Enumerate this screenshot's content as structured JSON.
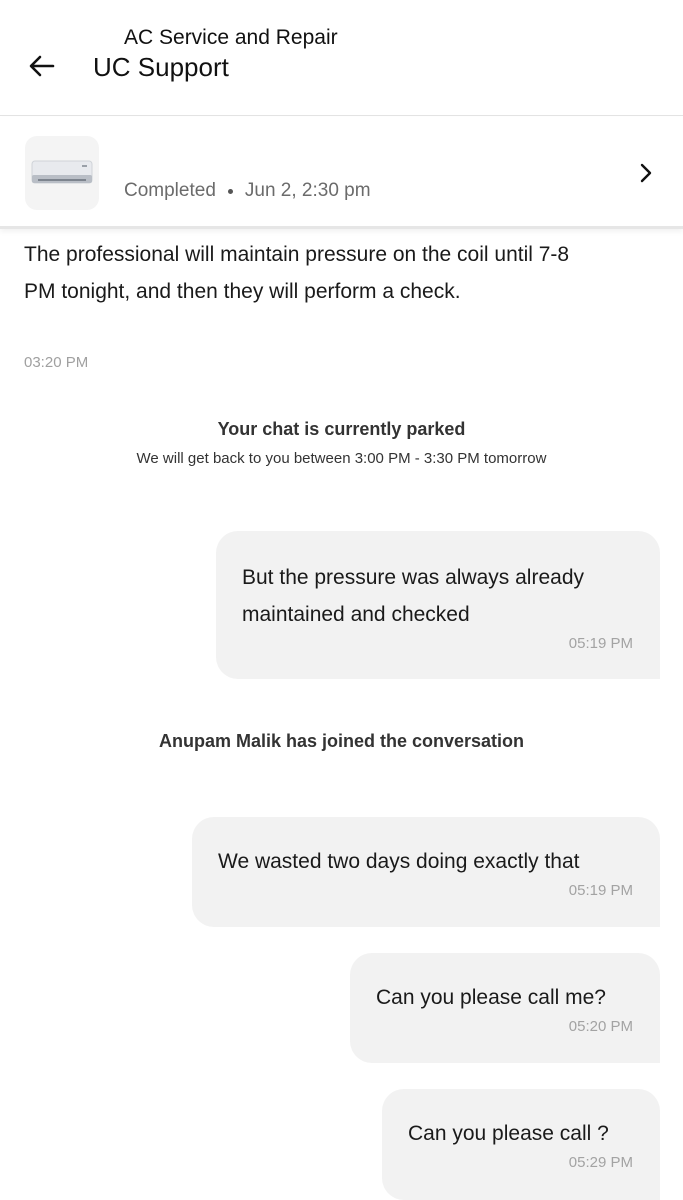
{
  "header": {
    "title": "UC Support",
    "back_icon": "arrow-left-icon"
  },
  "booking": {
    "title": "AC Service and Repair",
    "status": "Completed",
    "datetime": "Jun 2, 2:30 pm",
    "thumbnail": "air-conditioner-image",
    "chevron_icon": "chevron-right-icon"
  },
  "chat": {
    "agent_message": {
      "text": "The professional will maintain pressure on the coil until 7-8 PM tonight, and then they will perform a check.",
      "time": "03:20 PM"
    },
    "parked_notice": {
      "title": "Your chat is currently parked",
      "subtitle": "We will get back to you between 3:00 PM - 3:30 PM tomorrow"
    },
    "system_notice": "Anupam Malik has joined the conversation",
    "user_messages": [
      {
        "text": "But the pressure was always already maintained and checked",
        "time": "05:19 PM"
      },
      {
        "text": "We wasted two days doing exactly that",
        "time": "05:19 PM"
      },
      {
        "text": "Can you please call me?",
        "time": "05:20 PM"
      },
      {
        "text": "Can you please call ?",
        "time": "05:29 PM"
      }
    ]
  },
  "colors": {
    "bubble_background": "#f2f2f2",
    "timestamp": "#a3a3a3",
    "divider": "#e3e3e3"
  }
}
